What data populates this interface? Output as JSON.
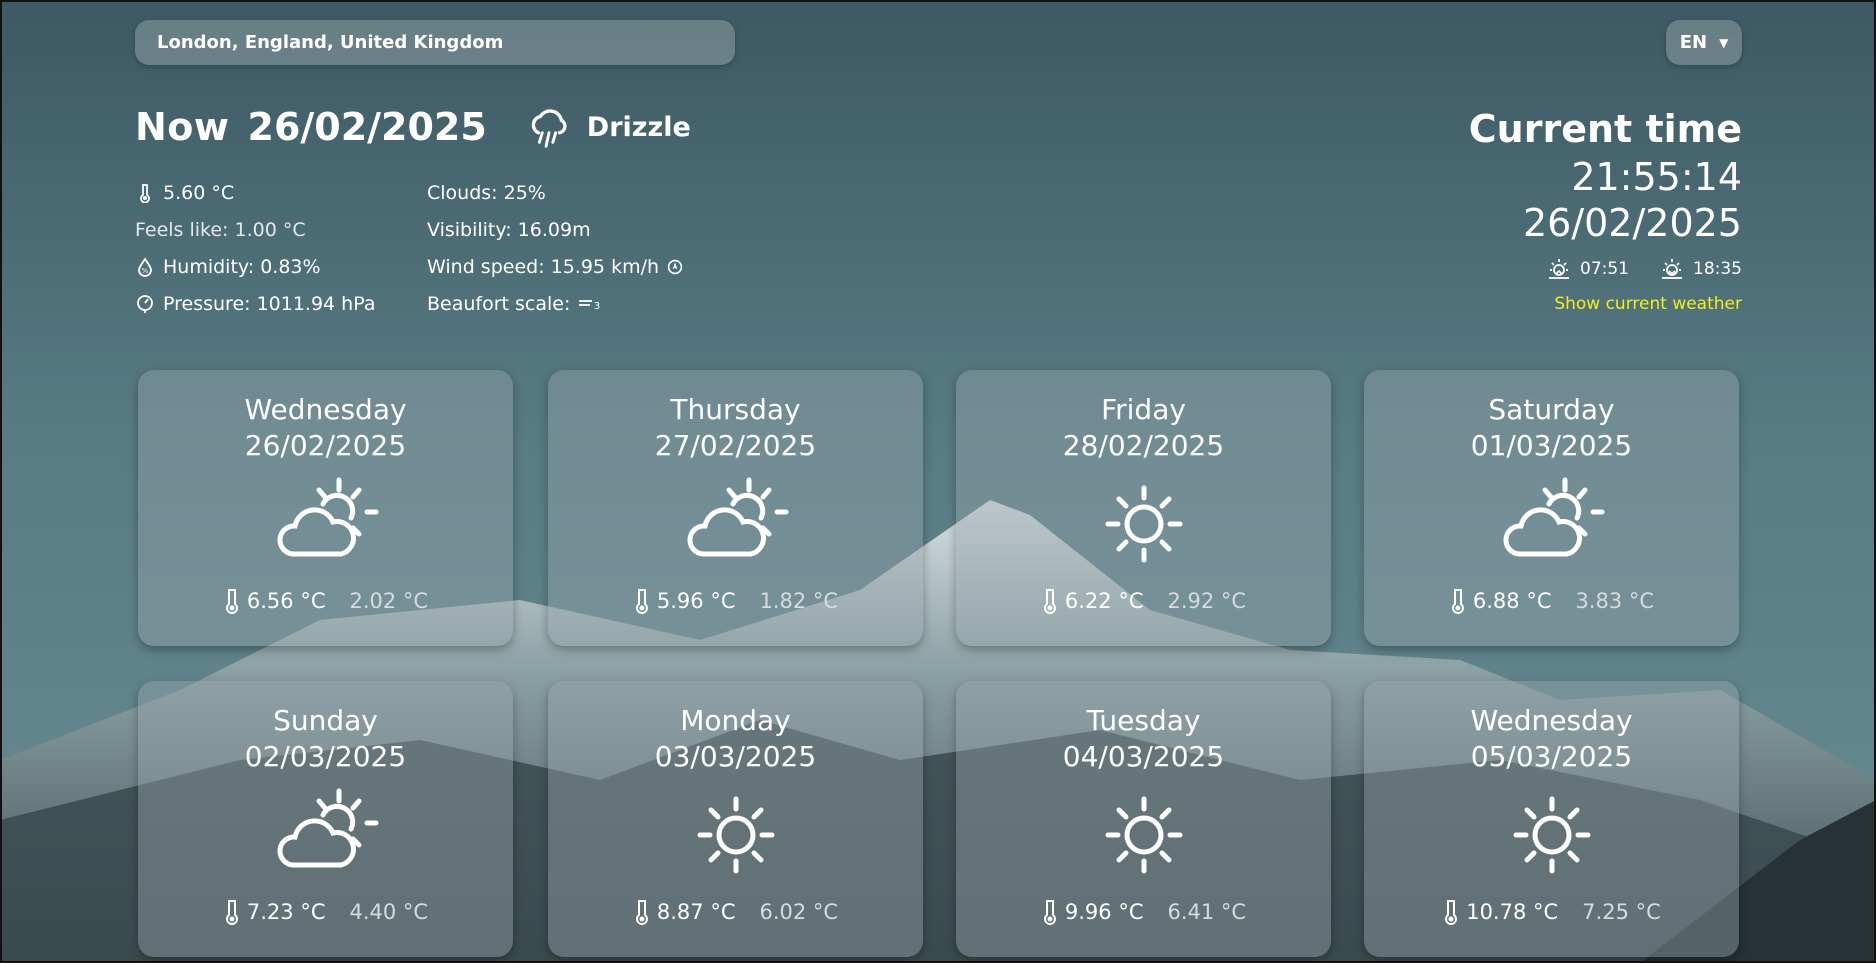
{
  "search": {
    "value": "London, England, United Kingdom"
  },
  "language": {
    "selected": "EN",
    "icon": "chevron-down-icon"
  },
  "now": {
    "label": "Now",
    "date": "26/02/2025",
    "condition": "Drizzle",
    "condition_icon": "drizzle-icon"
  },
  "details": {
    "temperature": "5.60 °C",
    "feels_like": "Feels like: 1.00 °C",
    "humidity": "Humidity: 0.83%",
    "pressure": "Pressure: 1011.94 hPa",
    "clouds": "Clouds: 25%",
    "visibility": "Visibility: 16.09m",
    "wind_speed": "Wind speed: 15.95 km/h",
    "beaufort": "Beaufort scale:"
  },
  "clock": {
    "title": "Current time",
    "time": "21:55:14",
    "date": "26/02/2025",
    "sunrise": "07:51",
    "sunset": "18:35",
    "show_current": "Show current weather"
  },
  "forecast": [
    {
      "day": "Wednesday",
      "date": "26/02/2025",
      "icon": "partly-cloudy-icon",
      "max": "6.56 °C",
      "min": "2.02 °C"
    },
    {
      "day": "Thursday",
      "date": "27/02/2025",
      "icon": "partly-cloudy-icon",
      "max": "5.96 °C",
      "min": "1.82 °C"
    },
    {
      "day": "Friday",
      "date": "28/02/2025",
      "icon": "sun-icon",
      "max": "6.22 °C",
      "min": "2.92 °C"
    },
    {
      "day": "Saturday",
      "date": "01/03/2025",
      "icon": "partly-cloudy-icon",
      "max": "6.88 °C",
      "min": "3.83 °C"
    },
    {
      "day": "Sunday",
      "date": "02/03/2025",
      "icon": "partly-cloudy-icon",
      "max": "7.23 °C",
      "min": "4.40 °C"
    },
    {
      "day": "Monday",
      "date": "03/03/2025",
      "icon": "sun-icon",
      "max": "8.87 °C",
      "min": "6.02 °C"
    },
    {
      "day": "Tuesday",
      "date": "04/03/2025",
      "icon": "sun-icon",
      "max": "9.96 °C",
      "min": "6.41 °C"
    },
    {
      "day": "Wednesday",
      "date": "05/03/2025",
      "icon": "sun-icon",
      "max": "10.78 °C",
      "min": "7.25 °C"
    }
  ]
}
